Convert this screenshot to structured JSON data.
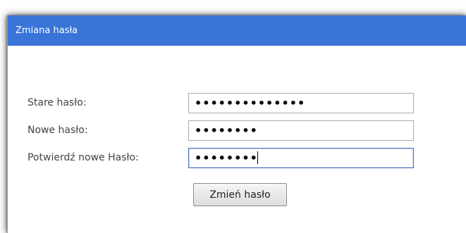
{
  "dialog": {
    "title": "Zmiana hasła"
  },
  "form": {
    "fields": [
      {
        "label": "Stare hasło:",
        "value": "xxxxxxxxxxxxxx",
        "type": "password",
        "focused": false
      },
      {
        "label": "Nowe hasło:",
        "value": "xxxxxxxx",
        "type": "password",
        "focused": false
      },
      {
        "label": "Potwierdź nowe Hasło:",
        "value": "xxxxxxxx",
        "type": "password",
        "focused": true
      }
    ],
    "submit_label": "Zmień hasło"
  },
  "colors": {
    "header_bg": "#3a74d9",
    "header_text": "#ffffff",
    "label_text": "#444444"
  }
}
